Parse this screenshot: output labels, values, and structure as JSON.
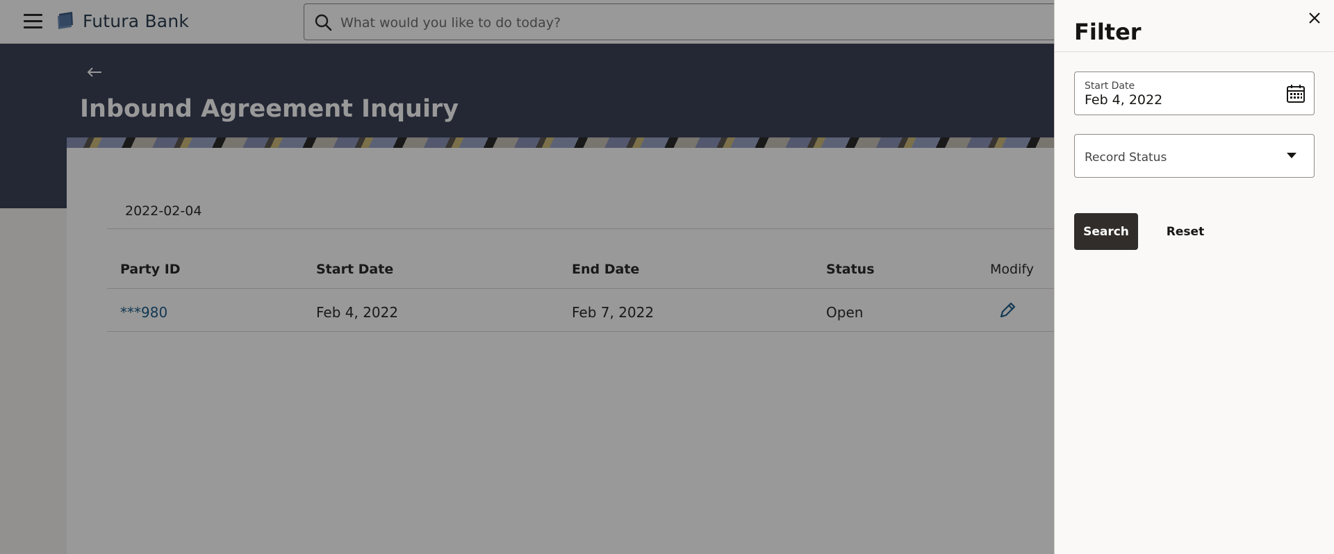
{
  "header": {
    "brand": "Futura Bank",
    "search_placeholder": "What would you like to do today?"
  },
  "page": {
    "title": "Inbound Agreement Inquiry",
    "date_heading": "2022-02-04"
  },
  "table": {
    "columns": [
      "Party ID",
      "Start Date",
      "End Date",
      "Status",
      "Modify"
    ],
    "rows": [
      {
        "party_id": "***980",
        "start_date": "Feb 4, 2022",
        "end_date": "Feb 7, 2022",
        "status": "Open"
      }
    ]
  },
  "filter": {
    "title": "Filter",
    "start_date_label": "Start Date",
    "start_date_value": "Feb 4, 2022",
    "record_status_placeholder": "Record Status",
    "search_label": "Search",
    "reset_label": "Reset"
  },
  "icons": {
    "menu": "hamburger-icon",
    "logo": "bank-logo-icon",
    "search": "search-icon",
    "back": "back-arrow-icon",
    "edit": "pencil-icon",
    "close": "close-icon",
    "calendar": "calendar-icon",
    "dropdown": "chevron-down-icon"
  },
  "colors": {
    "hero_bg": "#3d4258",
    "link": "#1e5e8a",
    "primary_button": "#312d2a"
  }
}
